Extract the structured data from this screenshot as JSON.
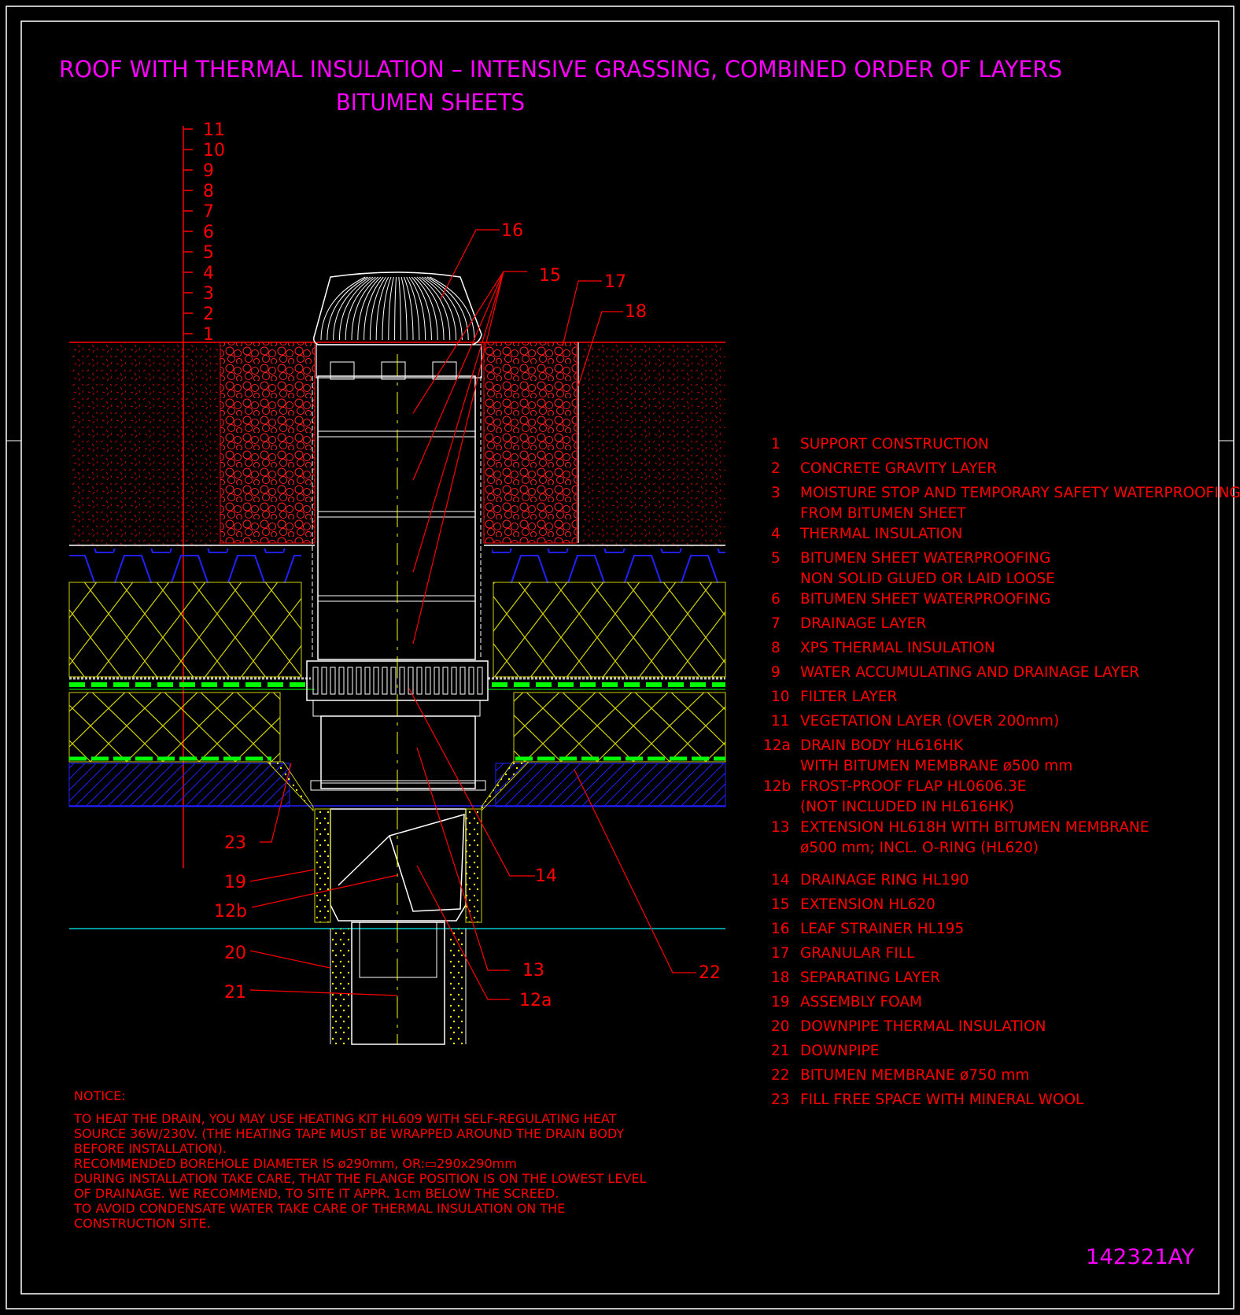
{
  "title": {
    "line1": "ROOF WITH THERMAL INSULATION – INTENSIVE GRASSING, COMBINED ORDER OF LAYERS",
    "line2": "BITUMEN SHEETS"
  },
  "drawing_number": "142321AY",
  "scale_labels": [
    "1",
    "2",
    "3",
    "4",
    "5",
    "6",
    "7",
    "8",
    "9",
    "10",
    "11"
  ],
  "callouts": {
    "c16": "16",
    "c15": "15",
    "c17": "17",
    "c18": "18",
    "c23": "23",
    "c19": "19",
    "c12b": "12b",
    "c20": "20",
    "c21": "21",
    "c14": "14",
    "c13": "13",
    "c12a": "12a",
    "c22": "22"
  },
  "legend": [
    {
      "num": "1",
      "lines": [
        "SUPPORT CONSTRUCTION"
      ]
    },
    {
      "num": "2",
      "lines": [
        "CONCRETE GRAVITY LAYER"
      ]
    },
    {
      "num": "3",
      "lines": [
        "MOISTURE STOP AND TEMPORARY SAFETY WATERPROOFING",
        "FROM BITUMEN SHEET"
      ]
    },
    {
      "num": "4",
      "lines": [
        "THERMAL INSULATION"
      ]
    },
    {
      "num": "5",
      "lines": [
        "BITUMEN SHEET WATERPROOFING",
        "NON SOLID GLUED OR LAID LOOSE"
      ]
    },
    {
      "num": "6",
      "lines": [
        "BITUMEN SHEET WATERPROOFING"
      ]
    },
    {
      "num": "7",
      "lines": [
        "DRAINAGE LAYER"
      ]
    },
    {
      "num": "8",
      "lines": [
        "XPS THERMAL INSULATION"
      ]
    },
    {
      "num": "9",
      "lines": [
        "WATER ACCUMULATING AND DRAINAGE LAYER"
      ]
    },
    {
      "num": "10",
      "lines": [
        "FILTER LAYER"
      ]
    },
    {
      "num": "11",
      "lines": [
        "VEGETATION LAYER (OVER 200mm)"
      ]
    },
    {
      "num": "12a",
      "lines": [
        "DRAIN BODY HL616HK",
        "WITH BITUMEN MEMBRANE ø500 mm"
      ]
    },
    {
      "num": "12b",
      "lines": [
        "FROST-PROOF FLAP HL0606.3E",
        "(NOT INCLUDED IN HL616HK)"
      ]
    },
    {
      "num": "13",
      "lines": [
        "EXTENSION HL618H WITH BITUMEN MEMBRANE",
        "ø500 mm; INCL. O-RING (HL620)"
      ]
    },
    {
      "num": "14",
      "lines": [
        "DRAINAGE RING HL190"
      ]
    },
    {
      "num": "15",
      "lines": [
        "EXTENSION HL620"
      ]
    },
    {
      "num": "16",
      "lines": [
        "LEAF STRAINER HL195"
      ]
    },
    {
      "num": "17",
      "lines": [
        "GRANULAR FILL"
      ]
    },
    {
      "num": "18",
      "lines": [
        "SEPARATING LAYER"
      ]
    },
    {
      "num": "19",
      "lines": [
        "ASSEMBLY FOAM"
      ]
    },
    {
      "num": "20",
      "lines": [
        "DOWNPIPE THERMAL INSULATION"
      ]
    },
    {
      "num": "21",
      "lines": [
        "DOWNPIPE"
      ]
    },
    {
      "num": "22",
      "lines": [
        "BITUMEN MEMBRANE ø750 mm"
      ]
    },
    {
      "num": "23",
      "lines": [
        "FILL FREE SPACE WITH MINERAL WOOL"
      ]
    }
  ],
  "notice": {
    "heading": "NOTICE:",
    "lines": [
      "TO HEAT THE DRAIN, YOU MAY USE HEATING KIT HL609 WITH SELF-REGULATING HEAT",
      "SOURCE 36W/230V. (THE HEATING TAPE MUST BE WRAPPED AROUND THE DRAIN BODY",
      "BEFORE INSTALLATION).",
      "RECOMMENDED BOREHOLE DIAMETER IS ø290mm, OR:▭290x290mm",
      "DURING INSTALLATION TAKE CARE, THAT THE FLANGE POSITION IS ON THE LOWEST LEVEL",
      "OF DRAINAGE. WE RECOMMEND, TO SITE IT APPR. 1cm BELOW THE SCREED.",
      "TO AVOID CONDENSATE WATER TAKE CARE OF THERMAL INSULATION ON THE",
      "CONSTRUCTION SITE."
    ]
  },
  "colors": {
    "background": "#000000",
    "title": "#ff00ff",
    "text": "#ff0000",
    "frame": "#ffffff",
    "insulation": "#ffff00",
    "drainage": "#0000ff",
    "membrane": "#00ff00",
    "screed_line": "#00c8c8"
  }
}
